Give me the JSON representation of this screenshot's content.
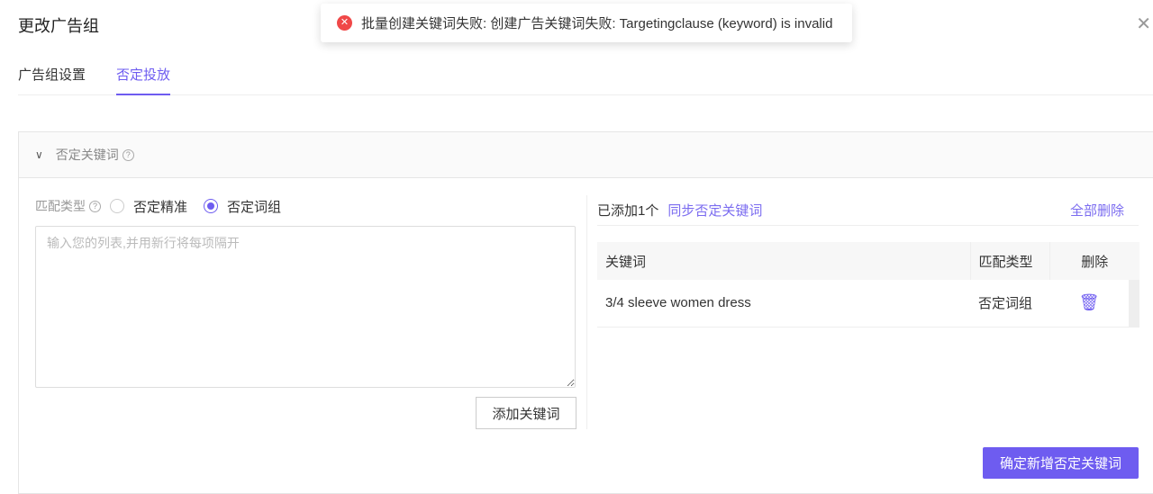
{
  "dialog": {
    "title": "更改广告组"
  },
  "tabs": [
    {
      "label": "广告组设置"
    },
    {
      "label": "否定投放"
    }
  ],
  "section": {
    "title": "否定关键词"
  },
  "match": {
    "label": "匹配类型",
    "options": [
      {
        "label": "否定精准",
        "selected": false
      },
      {
        "label": "否定词组",
        "selected": true
      }
    ]
  },
  "input": {
    "placeholder": "输入您的列表,并用新行将每项隔开",
    "value": ""
  },
  "add_button": "添加关键词",
  "added": {
    "count_label": "已添加1个",
    "sync_link": "同步否定关键词",
    "delete_all": "全部删除"
  },
  "table": {
    "headers": [
      "关键词",
      "匹配类型",
      "删除"
    ],
    "rows": [
      {
        "keyword": "3/4 sleeve women dress",
        "match": "否定词组"
      }
    ]
  },
  "confirm_button": "确定新增否定关键词",
  "toast": {
    "message": "批量创建关键词失败: 创建广告关键词失败: Targetingclause (keyword) is invalid"
  },
  "colors": {
    "accent": "#6e5cf0",
    "error": "#f04848"
  }
}
